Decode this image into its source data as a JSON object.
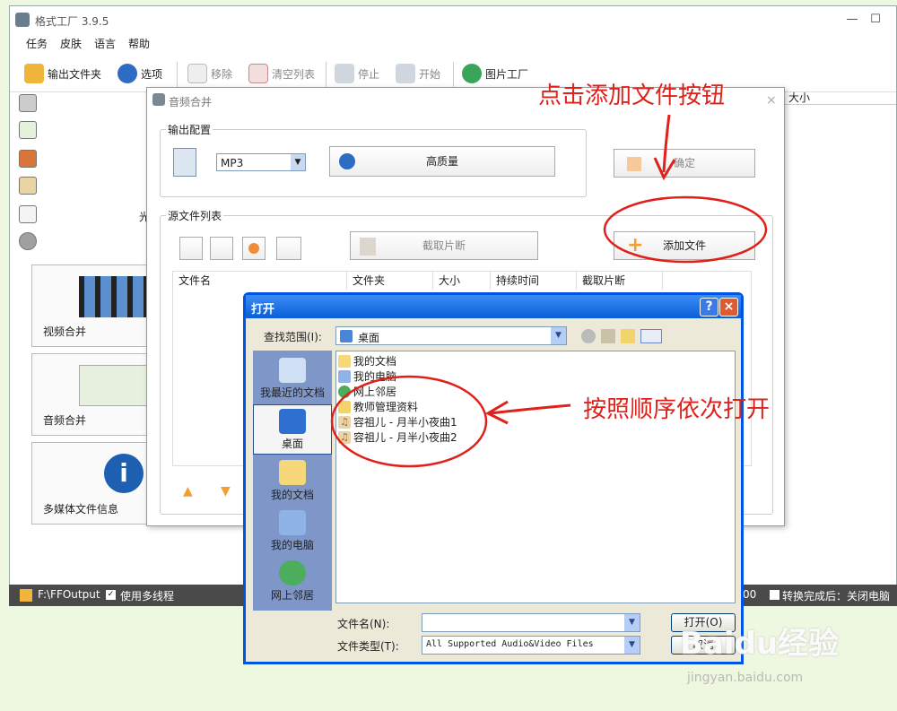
{
  "app": {
    "title": "格式工厂 3.9.5",
    "menu": [
      "任务",
      "皮肤",
      "语言",
      "帮助"
    ],
    "toolbar": {
      "output_folder": "输出文件夹",
      "options": "选项",
      "remove": "移除",
      "clear_list": "清空列表",
      "stop": "停止",
      "start": "开始",
      "picture_factory": "图片工厂"
    },
    "right_column_header": "大小",
    "sidebar_partial_label": "光",
    "cards": [
      {
        "label": "视频合并"
      },
      {
        "label": "音频合并"
      },
      {
        "label": "多媒体文件信息"
      }
    ],
    "status": {
      "output_path": "F:\\FFOutput",
      "multithread": "使用多线程",
      "time_partial": "00",
      "after_done": "转换完成后：关闭电脑"
    }
  },
  "merge_dialog": {
    "title": "音频合并",
    "output_config": "输出配置",
    "format": "MP3",
    "quality": "高质量",
    "confirm": "确定",
    "source_list": "源文件列表",
    "cut_clip": "截取片断",
    "add_file": "添加文件",
    "columns": [
      "文件名",
      "文件夹",
      "大小",
      "持续时间",
      "截取片断"
    ]
  },
  "open_dialog": {
    "title": "打开",
    "look_in_label": "查找范围(I):",
    "look_in_value": "桌面",
    "places": [
      "我最近的文档",
      "桌面",
      "我的文档",
      "我的电脑",
      "网上邻居"
    ],
    "files": [
      "我的文档",
      "我的电脑",
      "网上邻居",
      "教师管理资料",
      "容祖儿 - 月半小夜曲1",
      "容祖儿 - 月半小夜曲2"
    ],
    "filename_label": "文件名(N):",
    "filename_value": "",
    "filetype_label": "文件类型(T):",
    "filetype_value": "All Supported Audio&Video Files",
    "open_button": "打开(O)",
    "cancel_button": "取消"
  },
  "annotations": {
    "add_file_hint": "点击添加文件按钮",
    "open_order_hint": "按照顺序依次打开"
  },
  "watermark": {
    "brand": "Baidu经验",
    "url": "jingyan.baidu.com"
  }
}
